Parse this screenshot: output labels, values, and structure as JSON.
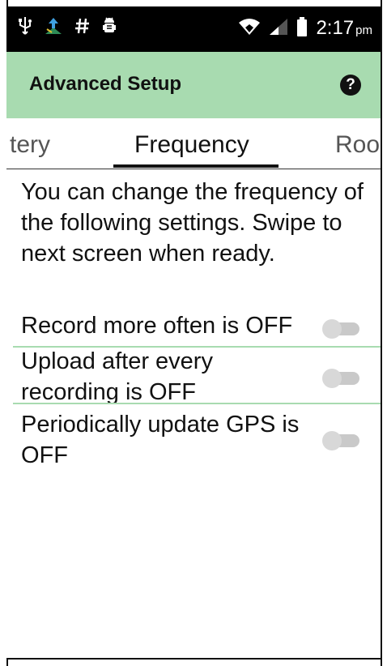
{
  "status_bar": {
    "icons_left": [
      "usb-icon",
      "upload-sync-icon",
      "hash-icon",
      "android-debug-icon"
    ],
    "icons_right": [
      "wifi-icon",
      "cell-signal-icon",
      "battery-icon"
    ],
    "time": "2:17",
    "ampm": "pm"
  },
  "app_bar": {
    "title": "Advanced Setup",
    "help_glyph": "?"
  },
  "tabs": {
    "prev_label": "tery",
    "active_label": "Frequency",
    "next_label": "Roo"
  },
  "content": {
    "intro_text": "You can change the frequency of the following settings. Swipe to next screen when ready."
  },
  "settings": [
    {
      "label": "Record more often is OFF",
      "state": "off"
    },
    {
      "label": "Upload after every recording is OFF",
      "state": "off"
    },
    {
      "label": "Periodically update GPS is OFF",
      "state": "off"
    }
  ],
  "colors": {
    "app_bar_bg": "#a8dbb0",
    "status_bar_bg": "#000000",
    "divider": "#a8dbb0",
    "toggle_off_track": "#c9c9c9",
    "toggle_off_thumb": "#d8d8d8"
  }
}
